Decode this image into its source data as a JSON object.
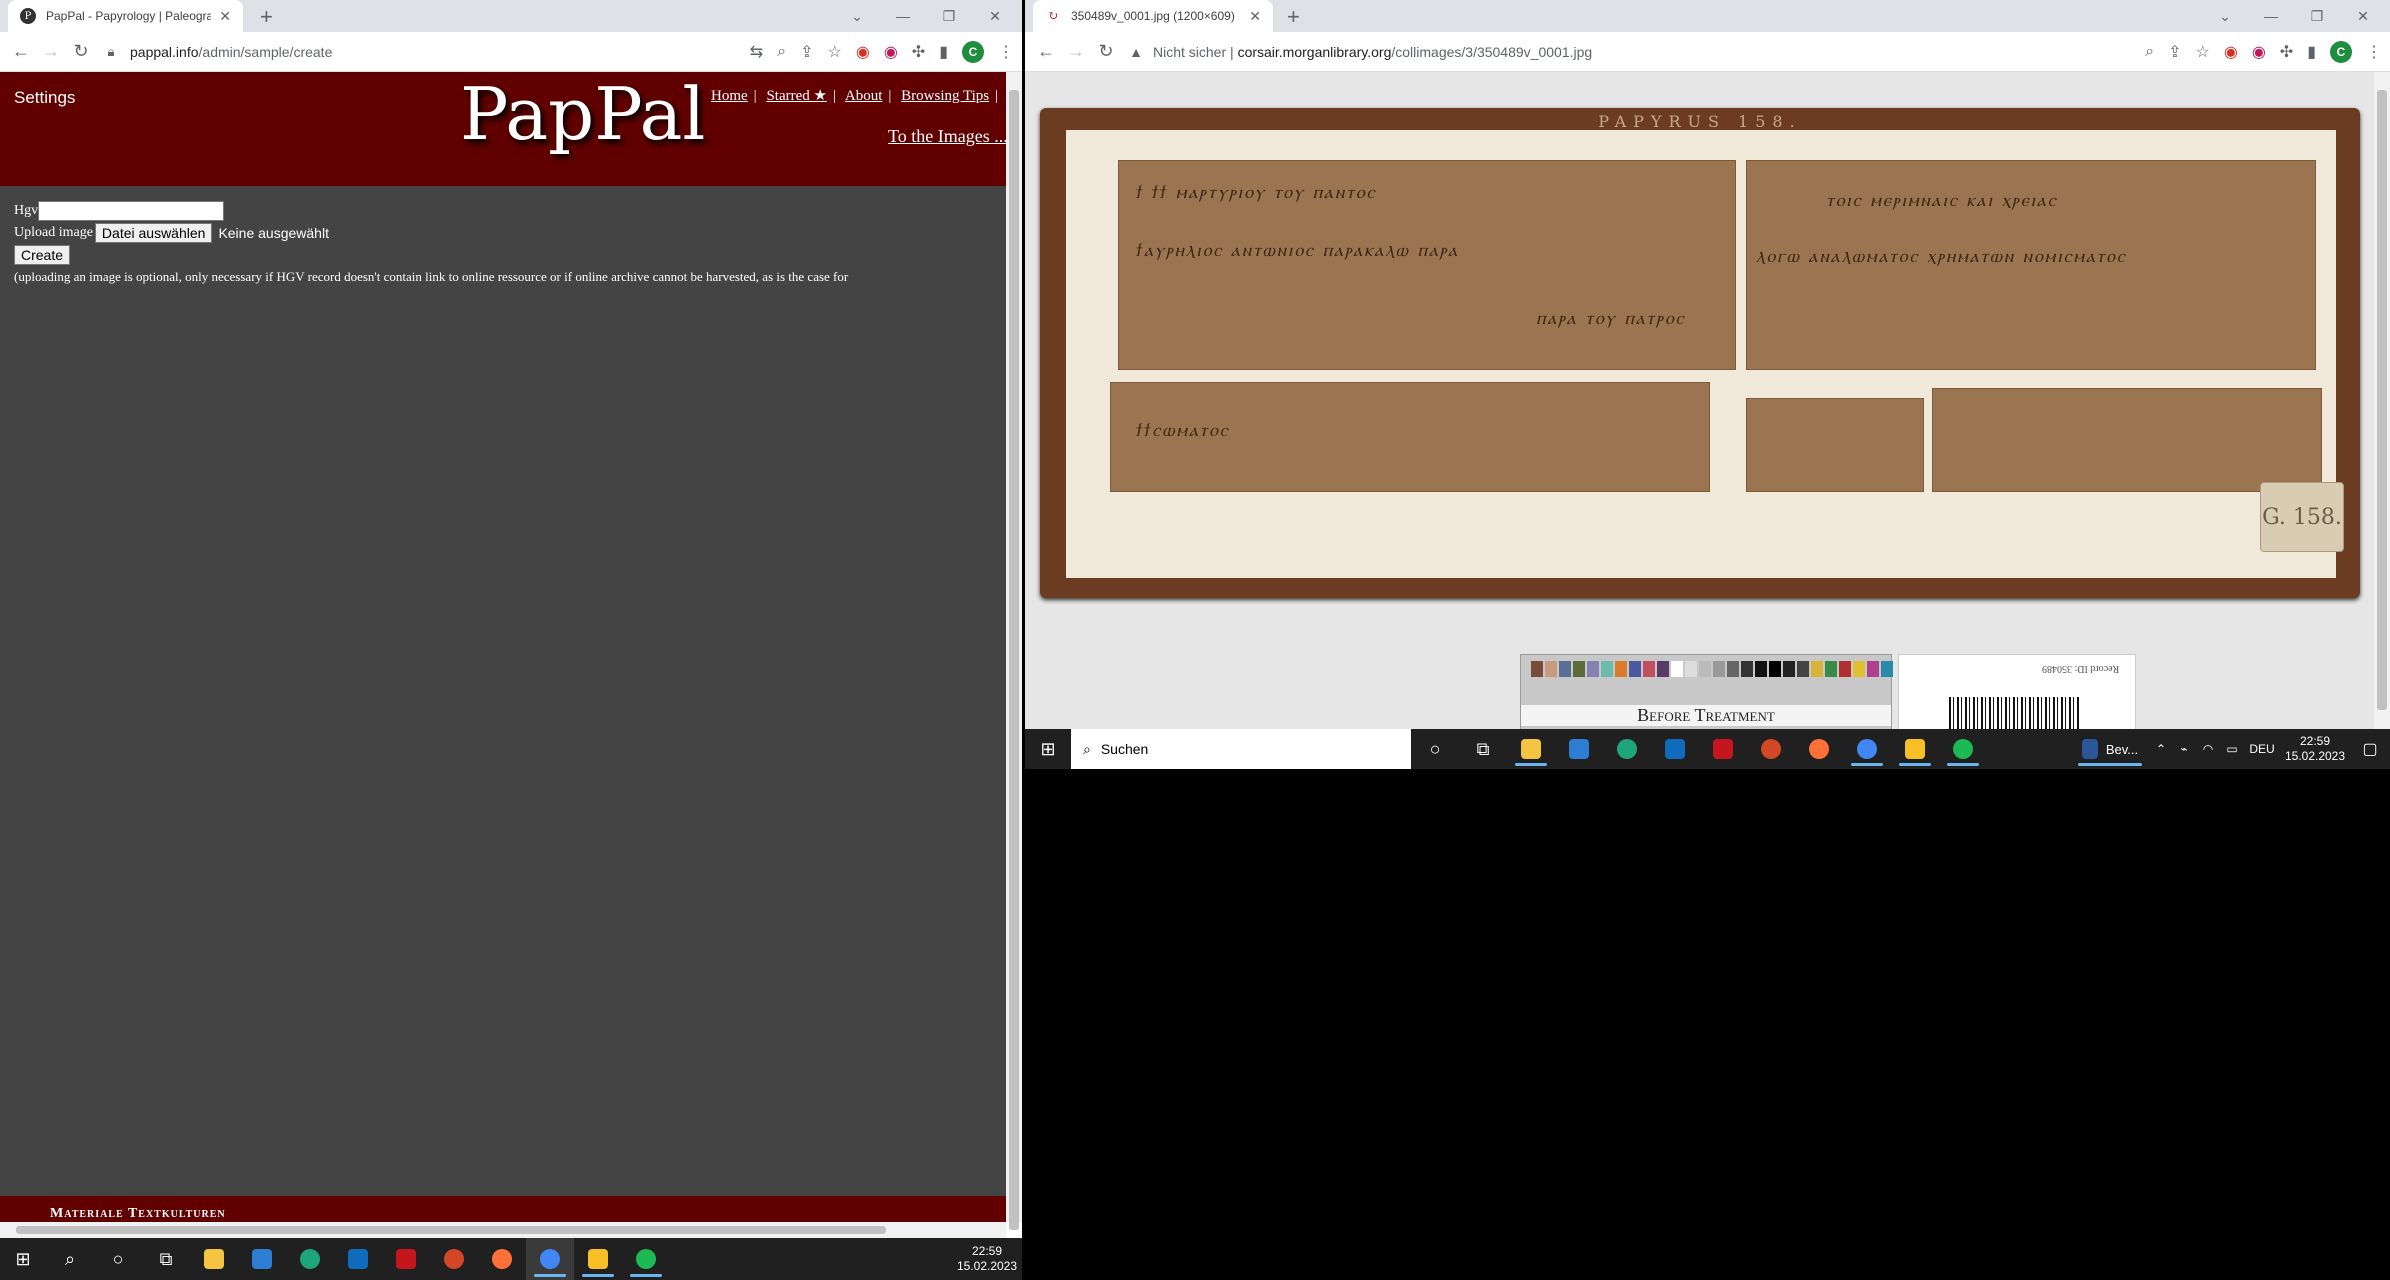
{
  "left_window": {
    "tab_title": "PapPal - Papyrology | Paleography",
    "url_host": "pappal.info",
    "url_path": "/admin/sample/create",
    "profile_initial": "C",
    "page": {
      "settings_label": "Settings",
      "logo": "PapPal",
      "nav": [
        "Home",
        "Starred ★",
        "About",
        "Browsing Tips"
      ],
      "to_images": "To the Images ...",
      "hgv_label": "Hgv",
      "hgv_value": "",
      "upload_label": "Upload image",
      "file_button": "Datei auswählen",
      "file_status": "Keine ausgewählt",
      "create_button": "Create",
      "note": "(uploading an image is optional, only necessary if HGV record doesn't contain link to online ressource or if online archive cannot be harvested, as is the case for",
      "footer": "Materiale Textkulturen"
    }
  },
  "right_window": {
    "tab_title": "350489v_0001.jpg (1200×609)",
    "security": "Nicht sicher",
    "url_host": "corsair.morganlibrary.org",
    "url_path": "/collimages/3/350489v_0001.jpg",
    "profile_initial": "C",
    "image": {
      "frame_label": "PAPYRUS 158.",
      "tag": "G. 158.",
      "chart_caption": "Before Treatment",
      "record_id": "Record ID: 350489",
      "script_lines": [
        "ϯ ϯϯ ⲙⲁⲣⲧⲩⲣⲓⲟⲩ ⲧⲟⲩ ⲡⲁⲛⲧⲟⲥ",
        "ϯⲁⲩⲣⲏⲗⲓⲟⲥ ⲁⲛⲧⲱⲛⲓⲟⲥ ⲡⲁⲣⲁⲕⲁⲗⲱ ⲡⲁⲣⲁ",
        "ⲡⲁⲣⲁ ⲧⲟⲩ ⲡⲁⲧⲣⲟⲥ",
        "ϯϯⲥⲱⲙⲁⲧⲟⲥ",
        "ⲧⲟⲓⲥ ⲙⲉⲣⲓⲙⲛⲁⲓⲥ ⲕⲁⲓ ⲭⲣⲉⲓⲁⲥ",
        "ⲗⲟⲅⲱ ⲁⲛⲁⲗⲱⲙⲁⲧⲟⲥ ⲭⲣⲏⲙⲁⲧⲱⲛ ⲛⲟⲙⲓⲥⲙⲁⲧⲟⲥ"
      ]
    }
  },
  "taskbar_left": {
    "time": "22:59",
    "date": "15.02.2023"
  },
  "taskbar_right": {
    "search_placeholder": "Suchen",
    "running_app_label": "Bev...",
    "language": "DEU",
    "time": "22:59",
    "date": "15.02.2023"
  },
  "colors": {
    "header_red": "#600000",
    "page_gray": "#444444",
    "frame_brown": "#6b3c22",
    "papyrus": "#9b7552"
  }
}
